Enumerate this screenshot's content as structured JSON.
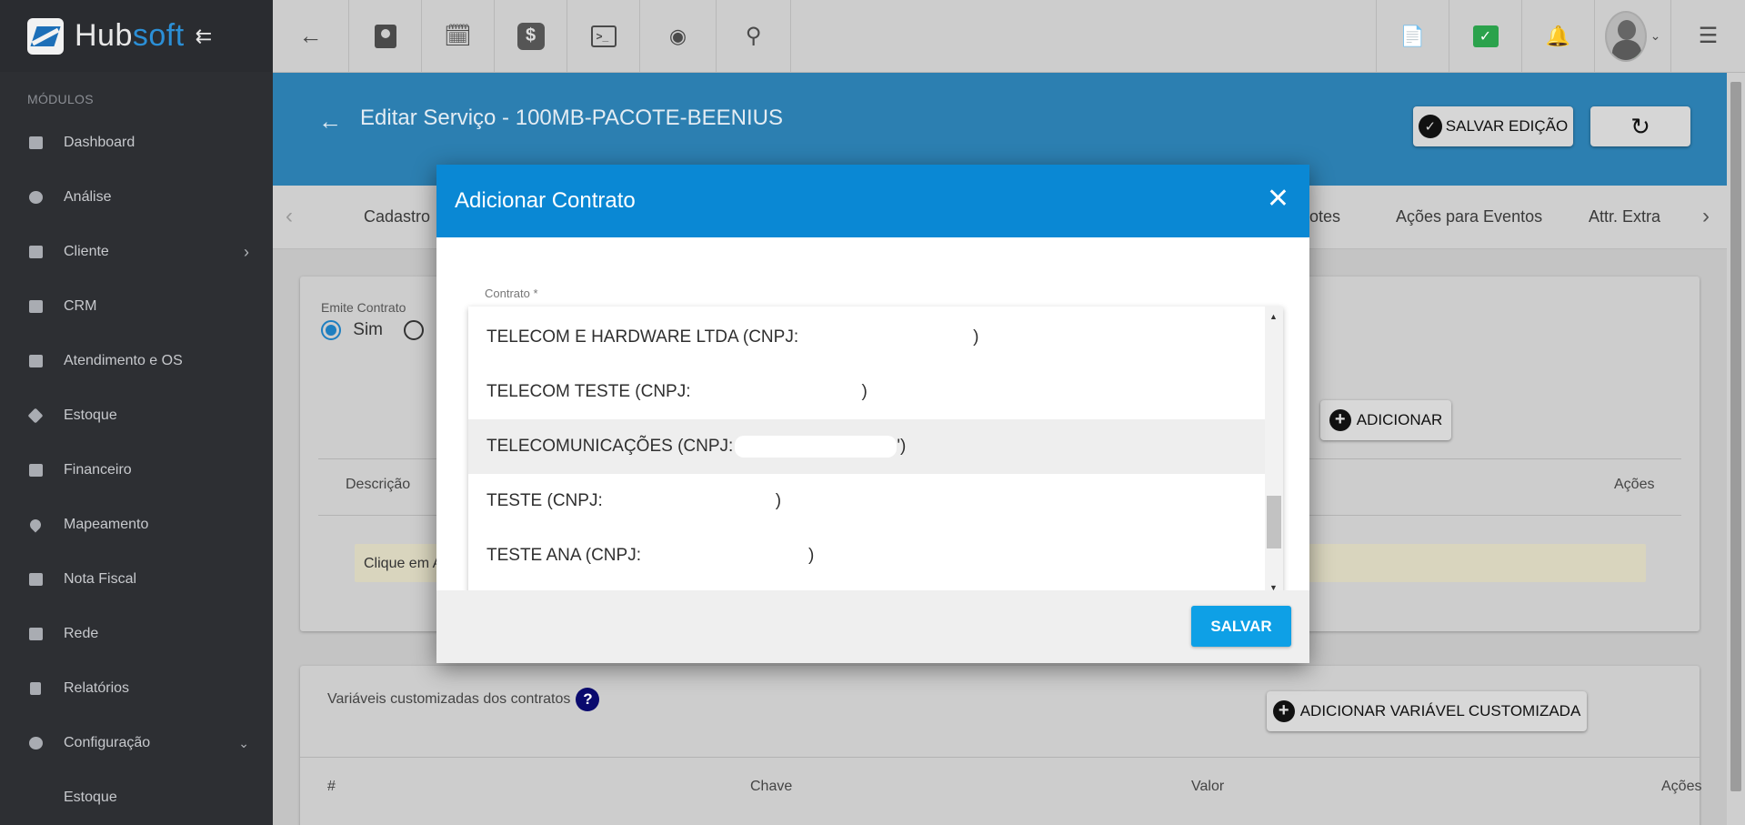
{
  "brand": {
    "name_prefix": "Hub",
    "name_suffix": "soft"
  },
  "sidebar": {
    "section_label": "MÓDULOS",
    "items": [
      {
        "label": "Dashboard",
        "icon": "dashboard-icon"
      },
      {
        "label": "Análise",
        "icon": "pie-chart-icon"
      },
      {
        "label": "Cliente",
        "icon": "contact-card-icon"
      },
      {
        "label": "CRM",
        "icon": "crm-board-icon"
      },
      {
        "label": "Atendimento e OS",
        "icon": "calendar-clock-icon"
      },
      {
        "label": "Estoque",
        "icon": "box-icon"
      },
      {
        "label": "Financeiro",
        "icon": "money-icon"
      },
      {
        "label": "Mapeamento",
        "icon": "map-pin-icon"
      },
      {
        "label": "Nota Fiscal",
        "icon": "invoice-icon"
      },
      {
        "label": "Rede",
        "icon": "server-icon"
      },
      {
        "label": "Relatórios",
        "icon": "report-icon"
      },
      {
        "label": "Configuração",
        "icon": "gear-icon"
      }
    ],
    "sub_items": [
      "Estoque"
    ]
  },
  "page": {
    "title": "Editar Serviço - 100MB-PACOTE-BEENIUS",
    "save_edit_label": "SALVAR EDIÇÃO"
  },
  "tabs": [
    "Cadastro",
    "otes",
    "Ações para Eventos",
    "Attr. Extra"
  ],
  "contracts_card": {
    "emite_label": "Emite Contrato",
    "sim_label": "Sim",
    "add_label": "ADICIONAR",
    "col_descricao": "Descrição",
    "col_acoes": "Ações",
    "info_text": "Clique em A"
  },
  "vars_card": {
    "title": "Variáveis customizadas dos contratos",
    "help": "?",
    "add_label": "ADICIONAR VARIÁVEL CUSTOMIZADA",
    "col_num": "#",
    "col_chave": "Chave",
    "col_valor": "Valor",
    "col_acoes": "Ações"
  },
  "modal": {
    "title": "Adicionar Contrato",
    "close": "✕",
    "field_label": "Contrato *",
    "options": [
      {
        "prefix": "TELECOM E HARDWARE LTDA (CNPJ:",
        "suffix": ")"
      },
      {
        "prefix": "TELECOM TESTE (CNPJ:",
        "suffix": ")"
      },
      {
        "prefix": "TELECOMUNICAÇÕES (CNPJ:",
        "suffix": "')"
      },
      {
        "prefix": "TESTE (CNPJ:",
        "suffix": ")"
      },
      {
        "prefix": "TESTE ANA (CNPJ:",
        "suffix": ")"
      }
    ],
    "save_label": "SALVAR"
  },
  "colors": {
    "sidebar_bg": "#2d2f33",
    "header_blue": "#2c7fb1",
    "modal_header": "#0a88d4",
    "save_button": "#0ea0e6",
    "online_green": "#3fae4a"
  }
}
